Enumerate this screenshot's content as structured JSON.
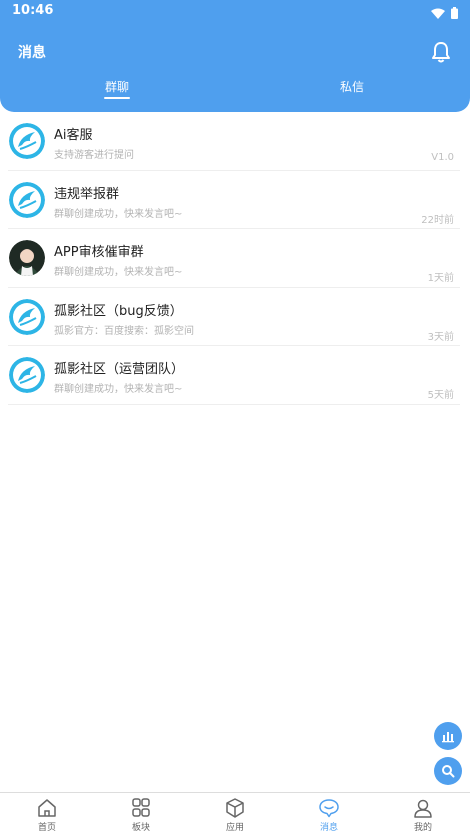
{
  "status_bar": {
    "time": "10:46",
    "icons": [
      "wifi-icon",
      "battery-icon"
    ]
  },
  "header": {
    "title": "消息",
    "bell_icon": "bell-icon"
  },
  "tabs": [
    {
      "label": "群聊",
      "active": true
    },
    {
      "label": "私信",
      "active": false
    }
  ],
  "chats": [
    {
      "title": "Ai客服",
      "subtitle": "支持游客进行提问",
      "time": "V1.0",
      "avatar": "bird-logo"
    },
    {
      "title": "违规举报群",
      "subtitle": "群聊创建成功，快来发言吧~",
      "time": "22时前",
      "avatar": "bird-logo"
    },
    {
      "title": "APP审核催审群",
      "subtitle": "群聊创建成功，快来发言吧~",
      "time": "1天前",
      "avatar": "person-photo"
    },
    {
      "title": "孤影社区（bug反馈）",
      "subtitle": "孤影官方：百度搜索：孤影空间",
      "time": "3天前",
      "avatar": "bird-logo"
    },
    {
      "title": "孤影社区（运营团队）",
      "subtitle": "群聊创建成功，快来发言吧~",
      "time": "5天前",
      "avatar": "bird-logo"
    }
  ],
  "fabs": [
    "chart-icon",
    "search-icon"
  ],
  "bottom_nav": [
    {
      "label": "首页",
      "icon": "home-icon",
      "active": false
    },
    {
      "label": "板块",
      "icon": "grid-icon",
      "active": false
    },
    {
      "label": "应用",
      "icon": "cube-icon",
      "active": false
    },
    {
      "label": "消息",
      "icon": "message-icon",
      "active": true
    },
    {
      "label": "我的",
      "icon": "profile-icon",
      "active": false
    }
  ],
  "colors": {
    "accent": "#4f9fee",
    "muted_text": "#b3b3b3",
    "divider": "#eeeeee"
  }
}
